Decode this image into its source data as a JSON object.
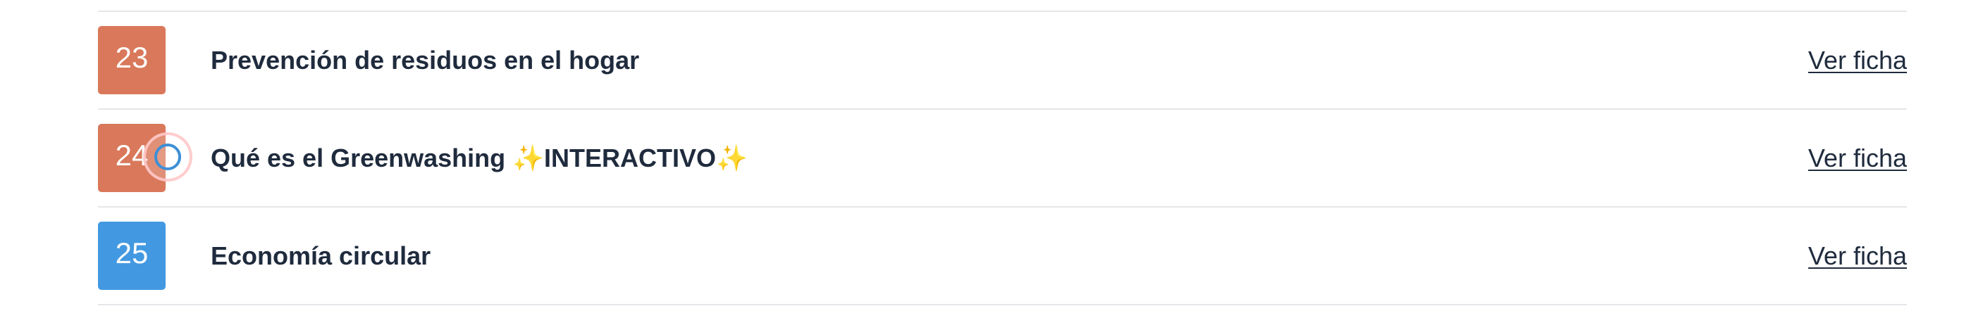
{
  "colors": {
    "badge_orange": "#d9785a",
    "badge_blue": "#4299e1",
    "text": "#1f2b3d",
    "divider": "#e4e6e9"
  },
  "items": [
    {
      "number": "23",
      "title": "Prevención de residuos en el hogar",
      "link": "Ver ficha",
      "badge_color": "#d9785a"
    },
    {
      "number": "24",
      "title": "Qué es el Greenwashing ✨INTERACTIVO✨",
      "link": "Ver ficha",
      "badge_color": "#d9785a"
    },
    {
      "number": "25",
      "title": "Economía circular",
      "link": "Ver ficha",
      "badge_color": "#4299e1"
    }
  ]
}
